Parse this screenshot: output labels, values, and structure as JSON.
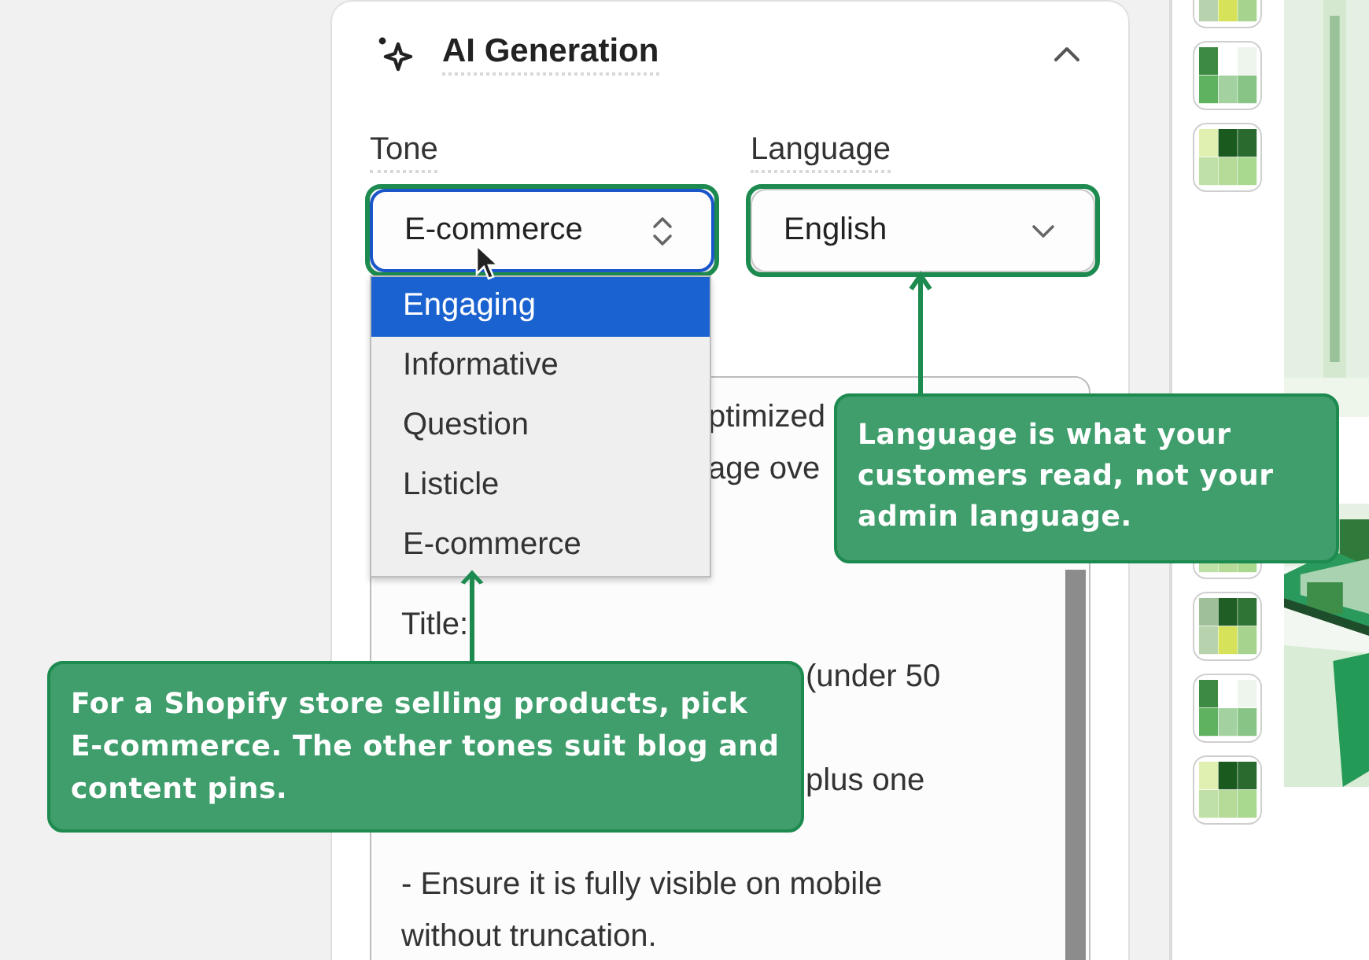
{
  "panel": {
    "title": "AI Generation",
    "expanded": true
  },
  "fields": [
    {
      "kind": "stepper",
      "label": "Tone",
      "value": "E-commerce",
      "focused": true,
      "highlighted": true
    },
    {
      "kind": "dropdown",
      "label": "Language",
      "value": "English",
      "focused": false,
      "highlighted": true
    }
  ],
  "tone_menu": {
    "options": [
      {
        "label": "Engaging",
        "selected": true
      },
      {
        "label": "Informative",
        "selected": false
      },
      {
        "label": "Question",
        "selected": false
      },
      {
        "label": "Listicle",
        "selected": false
      },
      {
        "label": "E-commerce",
        "selected": false
      }
    ]
  },
  "prompt_text": {
    "lines": [
      {
        "kind": "after-menu",
        "text": "ptimized"
      },
      {
        "kind": "after-menu",
        "text": "age ove"
      },
      {
        "kind": "blank"
      },
      {
        "kind": "blank"
      },
      {
        "kind": "full",
        "text": "Title:"
      },
      {
        "kind": "after-note",
        "text": "(under 50"
      },
      {
        "kind": "blank"
      },
      {
        "kind": "after-note",
        "text": "plus one"
      },
      {
        "kind": "blank"
      },
      {
        "kind": "full",
        "text": "- Ensure it is fully visible on mobile"
      },
      {
        "kind": "full",
        "text": "without truncation."
      }
    ]
  },
  "callouts": [
    {
      "text": "For a Shopify store selling products, pick E-commerce. The other tones suit blog and content pins."
    },
    {
      "text": "Language is what your customers read, not your admin language."
    }
  ]
}
